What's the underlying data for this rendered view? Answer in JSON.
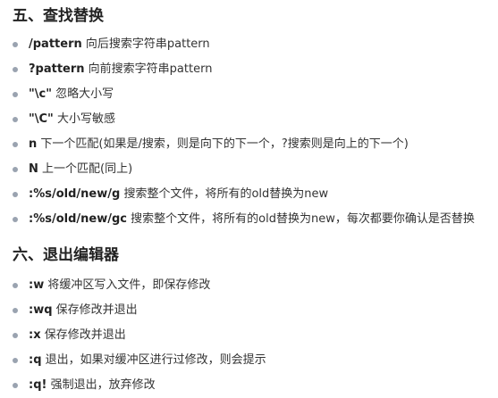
{
  "sections": [
    {
      "title": "五、查找替换",
      "items": [
        {
          "cmd": "/pattern",
          "desc": "向后搜索字符串pattern"
        },
        {
          "cmd": "?pattern",
          "desc": "向前搜索字符串pattern"
        },
        {
          "cmd": "\"\\c\"",
          "desc": "忽略大小写"
        },
        {
          "cmd": "\"\\C\"",
          "desc": "大小写敏感"
        },
        {
          "cmd": "n",
          "desc": "下一个匹配(如果是/搜索，则是向下的下一个，?搜索则是向上的下一个)"
        },
        {
          "cmd": "N",
          "desc": "上一个匹配(同上)"
        },
        {
          "cmd": ":%s/old/new/g",
          "desc": "搜索整个文件，将所有的old替换为new"
        },
        {
          "cmd": ":%s/old/new/gc",
          "desc": "搜索整个文件，将所有的old替换为new，每次都要你确认是否替换"
        }
      ]
    },
    {
      "title": "六、退出编辑器",
      "items": [
        {
          "cmd": ":w",
          "desc": "将缓冲区写入文件，即保存修改"
        },
        {
          "cmd": ":wq",
          "desc": "保存修改并退出"
        },
        {
          "cmd": ":x",
          "desc": "保存修改并退出"
        },
        {
          "cmd": ":q",
          "desc": "退出，如果对缓冲区进行过修改，则会提示"
        },
        {
          "cmd": ":q!",
          "desc": "强制退出，放弃修改"
        }
      ]
    }
  ]
}
